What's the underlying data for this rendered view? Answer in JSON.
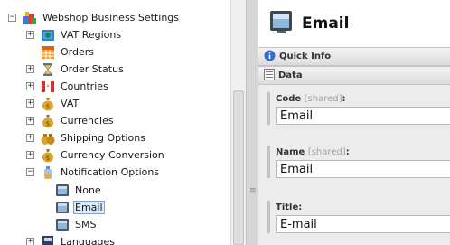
{
  "tree": {
    "root_label": "Webshop Business Settings",
    "items": [
      {
        "label": "VAT Regions"
      },
      {
        "label": "Orders"
      },
      {
        "label": "Order Status"
      },
      {
        "label": "Countries"
      },
      {
        "label": "VAT"
      },
      {
        "label": "Currencies"
      },
      {
        "label": "Shipping Options"
      },
      {
        "label": "Currency Conversion"
      },
      {
        "label": "Notification Options"
      },
      {
        "label": "Languages"
      }
    ],
    "children": [
      {
        "label": "None"
      },
      {
        "label": "Email"
      },
      {
        "label": "SMS"
      }
    ],
    "expand_symbol": "+",
    "collapse_symbol": "−",
    "grip_symbol": "≡"
  },
  "editor": {
    "title": "Email",
    "sections": [
      {
        "label": "Quick Info"
      },
      {
        "label": "Data"
      }
    ],
    "fields": [
      {
        "label": "Code",
        "shared": "[shared]",
        "colon": ":",
        "value": "Email"
      },
      {
        "label": "Name",
        "shared": "[shared]",
        "colon": ":",
        "value": "Email"
      },
      {
        "label": "Title:",
        "value": "E-mail"
      }
    ]
  },
  "colors": {
    "selection_bg": "#dcebfb",
    "selection_border": "#7da2ce",
    "panel_bg": "#ececec"
  }
}
